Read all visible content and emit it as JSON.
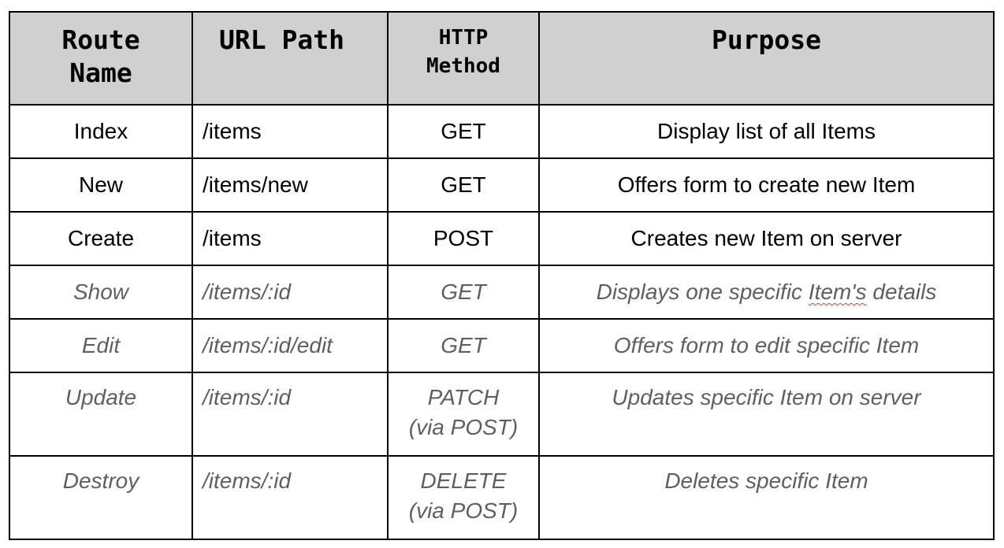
{
  "table": {
    "headers": {
      "route_name": [
        "Route",
        "Name"
      ],
      "url_path": "URL Path",
      "http_method": [
        "HTTP",
        "Method"
      ],
      "purpose": "Purpose"
    },
    "rows": [
      {
        "name": "Index",
        "url": "/items",
        "method": [
          "GET"
        ],
        "purpose": "Display list of all Items",
        "style": "normal"
      },
      {
        "name": "New",
        "url": "/items/new",
        "method": [
          "GET"
        ],
        "purpose": "Offers form to create new Item",
        "style": "normal"
      },
      {
        "name": "Create",
        "url": "/items",
        "method": [
          "POST"
        ],
        "purpose": "Creates new Item on server",
        "style": "normal"
      },
      {
        "name": "Show",
        "url": "/items/:id",
        "method": [
          "GET"
        ],
        "purpose_parts": [
          "Displays one specific ",
          "Item's",
          " details"
        ],
        "style": "italic-gray"
      },
      {
        "name": "Edit",
        "url": "/items/:id/edit",
        "method": [
          "GET"
        ],
        "purpose": "Offers form to edit specific Item",
        "style": "italic-gray"
      },
      {
        "name": "Update",
        "url": "/items/:id",
        "method": [
          "PATCH",
          "(via POST)"
        ],
        "purpose": "Updates specific Item on server",
        "style": "italic-gray"
      },
      {
        "name": "Destroy",
        "url": "/items/:id",
        "method": [
          "DELETE",
          "(via POST)"
        ],
        "purpose": "Deletes specific Item",
        "style": "italic-gray"
      }
    ]
  },
  "colors": {
    "header_background": "#d0d0d0",
    "border": "#000000",
    "italic_text": "#5f5f5f",
    "spellcheck_underline": "#d23b3b"
  }
}
